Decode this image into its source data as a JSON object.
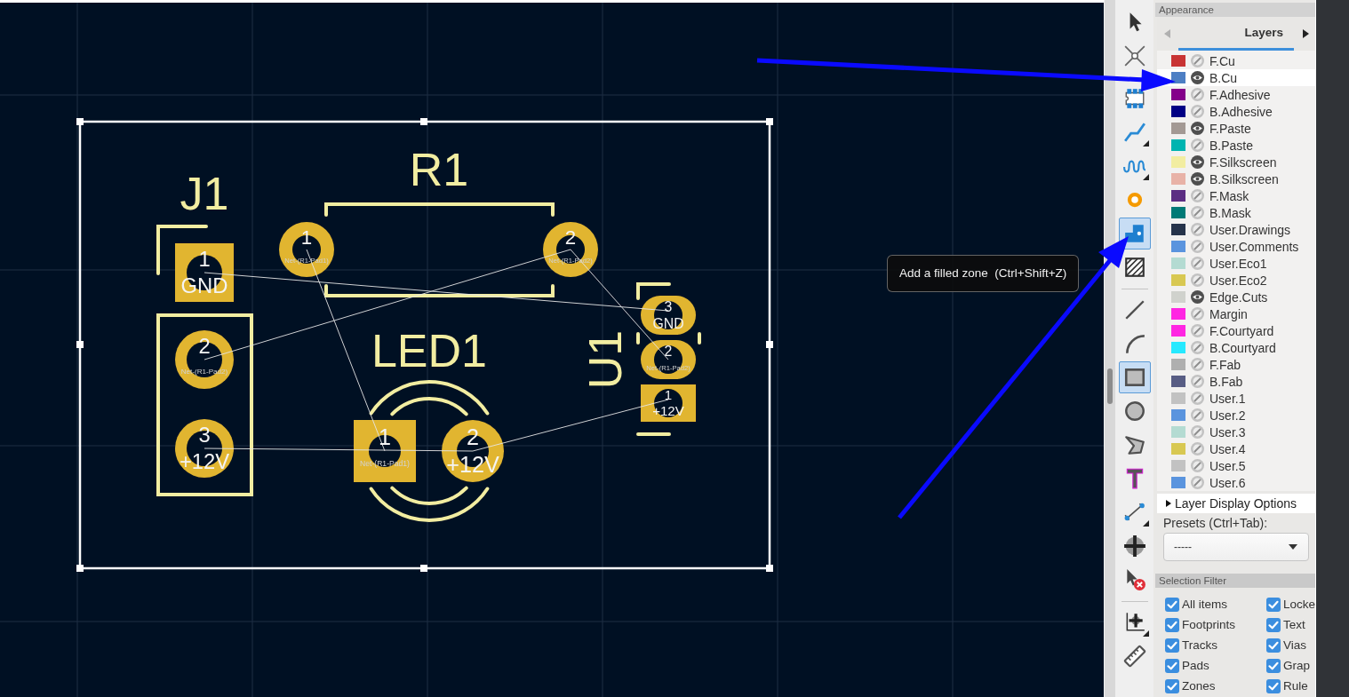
{
  "canvas": {
    "board_outline": {
      "selected": true
    },
    "footprints": [
      {
        "reference": "J1",
        "pads": [
          {
            "number": "1",
            "net": "GND",
            "kind": "square"
          },
          {
            "number": "2",
            "net": "Net-(R1-Pad2)",
            "kind": "round"
          },
          {
            "number": "3",
            "net": "+12V",
            "kind": "round"
          }
        ]
      },
      {
        "reference": "R1",
        "pads": [
          {
            "number": "1",
            "net": "Net-(R1-Pad1)",
            "kind": "round"
          },
          {
            "number": "2",
            "net": "Net-(R1-Pad2)",
            "kind": "round"
          }
        ]
      },
      {
        "reference": "LED1",
        "pads": [
          {
            "number": "1",
            "net": "Net-(R1-Pad1)",
            "kind": "square"
          },
          {
            "number": "2",
            "net": "+12V",
            "kind": "round"
          }
        ]
      },
      {
        "reference": "U1",
        "pads": [
          {
            "number": "3",
            "net": "GND",
            "kind": "oval"
          },
          {
            "number": "2",
            "net": "Net-(R1-Pad2)",
            "kind": "oval"
          },
          {
            "number": "1",
            "net": "+12V",
            "kind": "square"
          }
        ]
      }
    ]
  },
  "toolbar": {
    "tools": [
      {
        "selected": false,
        "submenu": false
      },
      {
        "selected": false,
        "submenu": false
      },
      {
        "selected": false,
        "submenu": false
      },
      {
        "selected": false,
        "submenu": true
      },
      {
        "selected": false,
        "submenu": true
      },
      {
        "selected": false,
        "submenu": false
      },
      {
        "selected": true,
        "submenu": false
      },
      {
        "selected": false,
        "submenu": false
      },
      {
        "selected": false,
        "submenu": false
      },
      {
        "selected": false,
        "submenu": false
      },
      {
        "selected": true,
        "submenu": false
      },
      {
        "selected": false,
        "submenu": false
      },
      {
        "selected": false,
        "submenu": false
      },
      {
        "selected": false,
        "submenu": false
      },
      {
        "selected": false,
        "submenu": true
      },
      {
        "selected": false,
        "submenu": false
      },
      {
        "selected": false,
        "submenu": false
      },
      {
        "selected": false,
        "submenu": true
      },
      {
        "selected": false,
        "submenu": false
      }
    ]
  },
  "tooltip": {
    "text": "Add a filled zone  (Ctrl+Shift+Z)"
  },
  "appearance": {
    "title": "Appearance",
    "tab_scroll": {
      "back_disabled": true,
      "forward_disabled": false
    },
    "tabs": [
      {
        "label": "Layers",
        "selected": true
      }
    ],
    "layers": [
      {
        "name": "F.Cu",
        "color": "#c83434",
        "visible": false,
        "selected": false
      },
      {
        "name": "B.Cu",
        "color": "#4d7fc4",
        "visible": true,
        "selected": true
      },
      {
        "name": "F.Adhesive",
        "color": "#84008a",
        "visible": false,
        "selected": false
      },
      {
        "name": "B.Adhesive",
        "color": "#000084",
        "visible": false,
        "selected": false
      },
      {
        "name": "F.Paste",
        "color": "#a39994",
        "visible": true,
        "selected": false
      },
      {
        "name": "B.Paste",
        "color": "#00b4b0",
        "visible": false,
        "selected": false
      },
      {
        "name": "F.Silkscreen",
        "color": "#f2eda1",
        "visible": true,
        "selected": false
      },
      {
        "name": "B.Silkscreen",
        "color": "#e8b2a7",
        "visible": true,
        "selected": false
      },
      {
        "name": "F.Mask",
        "color": "#5c2e83",
        "visible": false,
        "selected": false
      },
      {
        "name": "B.Mask",
        "color": "#007a76",
        "visible": false,
        "selected": false
      },
      {
        "name": "User.Drawings",
        "color": "#26334a",
        "visible": false,
        "selected": false
      },
      {
        "name": "User.Comments",
        "color": "#5a94de",
        "visible": false,
        "selected": false
      },
      {
        "name": "User.Eco1",
        "color": "#b4dbd2",
        "visible": false,
        "selected": false
      },
      {
        "name": "User.Eco2",
        "color": "#d8c852",
        "visible": false,
        "selected": false
      },
      {
        "name": "Edge.Cuts",
        "color": "#d0d2cd",
        "visible": true,
        "selected": false
      },
      {
        "name": "Margin",
        "color": "#ff26e2",
        "visible": false,
        "selected": false
      },
      {
        "name": "F.Courtyard",
        "color": "#ff26e2",
        "visible": false,
        "selected": false
      },
      {
        "name": "B.Courtyard",
        "color": "#26e9ff",
        "visible": false,
        "selected": false
      },
      {
        "name": "F.Fab",
        "color": "#afafaf",
        "visible": false,
        "selected": false
      },
      {
        "name": "B.Fab",
        "color": "#585d84",
        "visible": false,
        "selected": false
      },
      {
        "name": "User.1",
        "color": "#c2c2c2",
        "visible": false,
        "selected": false
      },
      {
        "name": "User.2",
        "color": "#5a94de",
        "visible": false,
        "selected": false
      },
      {
        "name": "User.3",
        "color": "#b4dbd2",
        "visible": false,
        "selected": false
      },
      {
        "name": "User.4",
        "color": "#d8c852",
        "visible": false,
        "selected": false
      },
      {
        "name": "User.5",
        "color": "#c2c2c2",
        "visible": false,
        "selected": false
      },
      {
        "name": "User.6",
        "color": "#5a94de",
        "visible": false,
        "selected": false
      }
    ],
    "layer_display_options": {
      "label": "Layer Display Options",
      "expanded": false
    },
    "presets": {
      "label": "Presets (Ctrl+Tab):",
      "value": "-----"
    }
  },
  "selection_filter": {
    "title": "Selection Filter",
    "items": [
      {
        "label": "All items",
        "checked": true
      },
      {
        "label": "Locke",
        "checked": true
      },
      {
        "label": "Footprints",
        "checked": true
      },
      {
        "label": "Text",
        "checked": true
      },
      {
        "label": "Tracks",
        "checked": true
      },
      {
        "label": "Vias",
        "checked": true
      },
      {
        "label": "Pads",
        "checked": true
      },
      {
        "label": "Grap",
        "checked": true
      },
      {
        "label": "Zones",
        "checked": true
      },
      {
        "label": "Rule",
        "checked": true
      }
    ]
  }
}
